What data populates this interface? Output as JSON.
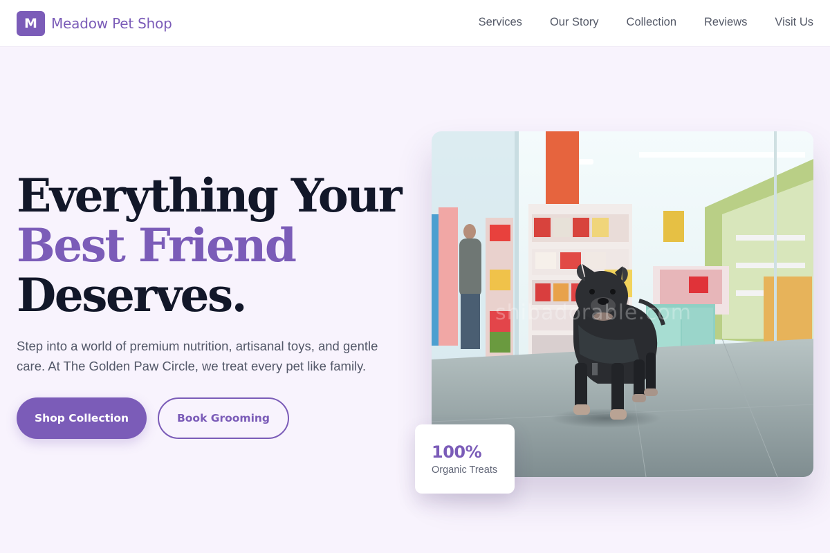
{
  "brand": {
    "logo_letter": "M",
    "name": "Meadow Pet Shop"
  },
  "nav": {
    "items": [
      "Services",
      "Our Story",
      "Collection",
      "Reviews",
      "Visit Us"
    ]
  },
  "hero": {
    "title_line1": "Everything Your",
    "title_line2": "Best Friend",
    "title_line3": "Deserves.",
    "description": "Step into a world of premium nutrition, artisanal toys, and gentle care. At The Golden Paw Circle, we treat every pet like family.",
    "primary_button": "Shop Collection",
    "secondary_button": "Book Grooming"
  },
  "photo": {
    "subject": "french-bulldog-in-pet-shop",
    "watermark": "shibadorable.com"
  },
  "stat": {
    "value": "100%",
    "label": "Organic Treats"
  },
  "colors": {
    "accent": "#7b5cb8",
    "background": "#f8f3fd",
    "heading": "#121729",
    "body_text": "#535869"
  }
}
